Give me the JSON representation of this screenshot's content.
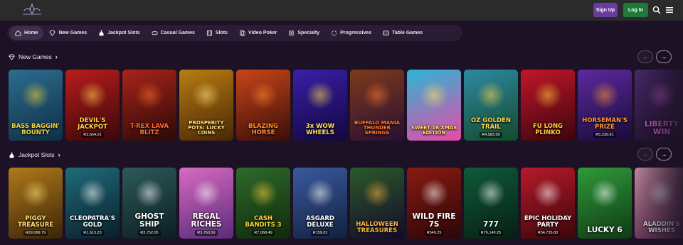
{
  "header": {
    "signup_label": "Sign Up",
    "login_label": "Log In",
    "colors": {
      "signup": "#6a3a9e",
      "login": "#1e7a3a",
      "bar": "#2b2b2b"
    }
  },
  "nav": [
    {
      "label": "Home",
      "icon": "home-icon",
      "active": true
    },
    {
      "label": "New Games",
      "icon": "diamond-icon",
      "active": false
    },
    {
      "label": "Jackpot Slots",
      "icon": "money-bag-icon",
      "active": false
    },
    {
      "label": "Casual Games",
      "icon": "controller-icon",
      "active": false
    },
    {
      "label": "Slots",
      "icon": "slot-icon",
      "active": false
    },
    {
      "label": "Video Poker",
      "icon": "cards-icon",
      "active": false
    },
    {
      "label": "Specialty",
      "icon": "puzzle-icon",
      "active": false
    },
    {
      "label": "Progressives",
      "icon": "progress-icon",
      "active": false
    },
    {
      "label": "Table Games",
      "icon": "table-icon",
      "active": false
    }
  ],
  "sections": {
    "new_games": {
      "title": "New Games",
      "icon": "diamond-icon",
      "games": [
        {
          "title": "BASS BAGGIN' BOUNTY",
          "jackpot": "",
          "bg": "#2d6d8f",
          "bg2": "#0e2f46",
          "color": "#f6d23a"
        },
        {
          "title": "DEVIL'S JACKPOT",
          "jackpot": "R3,654.01",
          "bg": "#b81d1d",
          "bg2": "#3a0707",
          "color": "#ffd54a"
        },
        {
          "title": "T-REX LAVA BLITZ",
          "jackpot": "",
          "bg": "#a8241a",
          "bg2": "#2b0906",
          "color": "#ff6d2e"
        },
        {
          "title": "PROSPERITY POTS: LUCKY COINS",
          "jackpot": "",
          "bg": "#b87d12",
          "bg2": "#4a2606",
          "color": "#ffe27a"
        },
        {
          "title": "BLAZING HORSE",
          "jackpot": "",
          "bg": "#c7461a",
          "bg2": "#3b0d07",
          "color": "#ff8a2a"
        },
        {
          "title": "3x WOW WHEELS",
          "jackpot": "",
          "bg": "#3a1fa8",
          "bg2": "#12073f",
          "color": "#ffe14a"
        },
        {
          "title": "BUFFALO MANIA THUNDER SPRINGS",
          "jackpot": "",
          "bg": "#7d3a1c",
          "bg2": "#2a0f33",
          "color": "#ff7a2a"
        },
        {
          "title": "SWEET 16 XMAS EDITION",
          "jackpot": "",
          "bg": "#2cb6d6",
          "bg2": "#e94aa5",
          "color": "#ffe45a"
        },
        {
          "title": "OZ GOLDEN TRAIL",
          "jackpot": "R4,583.50",
          "bg": "#2e8aa3",
          "bg2": "#124a2b",
          "color": "#ffd54a"
        },
        {
          "title": "FU LONG PLINKO",
          "jackpot": "",
          "bg": "#c2162a",
          "bg2": "#3a060c",
          "color": "#ffd23a"
        },
        {
          "title": "HORSEMAN'S PRIZE",
          "jackpot": "R5,230.81",
          "bg": "#5c2a9e",
          "bg2": "#1a0a3a",
          "color": "#ff9a2a"
        },
        {
          "title": "LIBERTY WIN",
          "jackpot": "",
          "bg": "#4a2a6e",
          "bg2": "#1c0f2a",
          "color": "#d96ad9"
        }
      ]
    },
    "jackpot_slots": {
      "title": "Jackpot Slots",
      "icon": "money-bag-icon",
      "games": [
        {
          "title": "PIGGY TREASURE",
          "jackpot": "R29,099.79",
          "bg": "#b07a1a",
          "bg2": "#3b2408",
          "color": "#ffe27a"
        },
        {
          "title": "CLEOPATRA'S GOLD",
          "jackpot": "R1,613.23",
          "bg": "#1f6b7a",
          "bg2": "#0a1f2a",
          "color": "#ffffff"
        },
        {
          "title": "GHOST SHIP",
          "jackpot": "R3,752.05",
          "bg": "#2d5a5a",
          "bg2": "#0b1e22",
          "color": "#ffffff"
        },
        {
          "title": "REGAL RICHES",
          "jackpot": "R3,763.56",
          "bg": "#d86bc0",
          "bg2": "#5a2a7a",
          "color": "#ffffff"
        },
        {
          "title": "CASH BANDITS 3",
          "jackpot": "R7,068.49",
          "bg": "#2f6a2a",
          "bg2": "#0f2a0c",
          "color": "#ffd23a"
        },
        {
          "title": "ASGARD DELUXE",
          "jackpot": "R159.02",
          "bg": "#3a5a9e",
          "bg2": "#12203f",
          "color": "#ffffff"
        },
        {
          "title": "HALLOWEEN TREASURES",
          "jackpot": "",
          "bg": "#2a5a2a",
          "bg2": "#140a2a",
          "color": "#ffb23a"
        },
        {
          "title": "WILD FIRE 7S",
          "jackpot": "R549.25",
          "bg": "#8a1a14",
          "bg2": "#2a0606",
          "color": "#ffffff"
        },
        {
          "title": "777",
          "jackpot": "R76,149.25",
          "bg": "#0f5a3a",
          "bg2": "#061f14",
          "color": "#ffffff"
        },
        {
          "title": "EPIC HOLIDAY PARTY",
          "jackpot": "R54,735.83",
          "bg": "#b81a2a",
          "bg2": "#3a060a",
          "color": "#ffffff"
        },
        {
          "title": "LUCKY 6",
          "jackpot": "",
          "bg": "#2f9a3a",
          "bg2": "#0f3a14",
          "color": "#ffffff"
        },
        {
          "title": "ALADDIN'S WISHES",
          "jackpot": "",
          "bg": "#c28aa0",
          "bg2": "#5a2a4a",
          "color": "#ffffff"
        }
      ]
    }
  }
}
